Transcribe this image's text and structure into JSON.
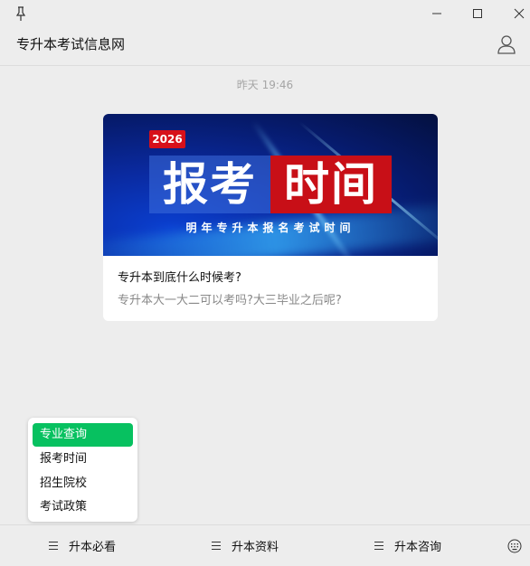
{
  "window": {
    "title": "专升本考试信息网",
    "icons": {
      "pin": "pin-icon",
      "minimize": "minimize-icon",
      "maximize": "maximize-icon",
      "close": "close-icon",
      "profile": "profile-icon"
    }
  },
  "chat": {
    "timestamp": "昨天 19:46",
    "article": {
      "banner": {
        "year": "2026",
        "headline_left": "报考",
        "headline_right": "时间",
        "subtitle": "明年专升本报名考试时间"
      },
      "title": "专升本到底什么时候考?",
      "description": "专升本大一大二可以考吗?大三毕业之后呢?"
    }
  },
  "popup_menu": {
    "items": [
      {
        "label": "专业查询",
        "active": true
      },
      {
        "label": "报考时间",
        "active": false
      },
      {
        "label": "招生院校",
        "active": false
      },
      {
        "label": "考试政策",
        "active": false
      }
    ]
  },
  "bottom_menu": {
    "tabs": [
      {
        "label": "升本必看"
      },
      {
        "label": "升本资料"
      },
      {
        "label": "升本咨询"
      }
    ],
    "keyboard_icon": "keyboard-icon"
  },
  "colors": {
    "accent": "#07c160",
    "badge_red": "#d7101a",
    "background": "#ededed"
  }
}
